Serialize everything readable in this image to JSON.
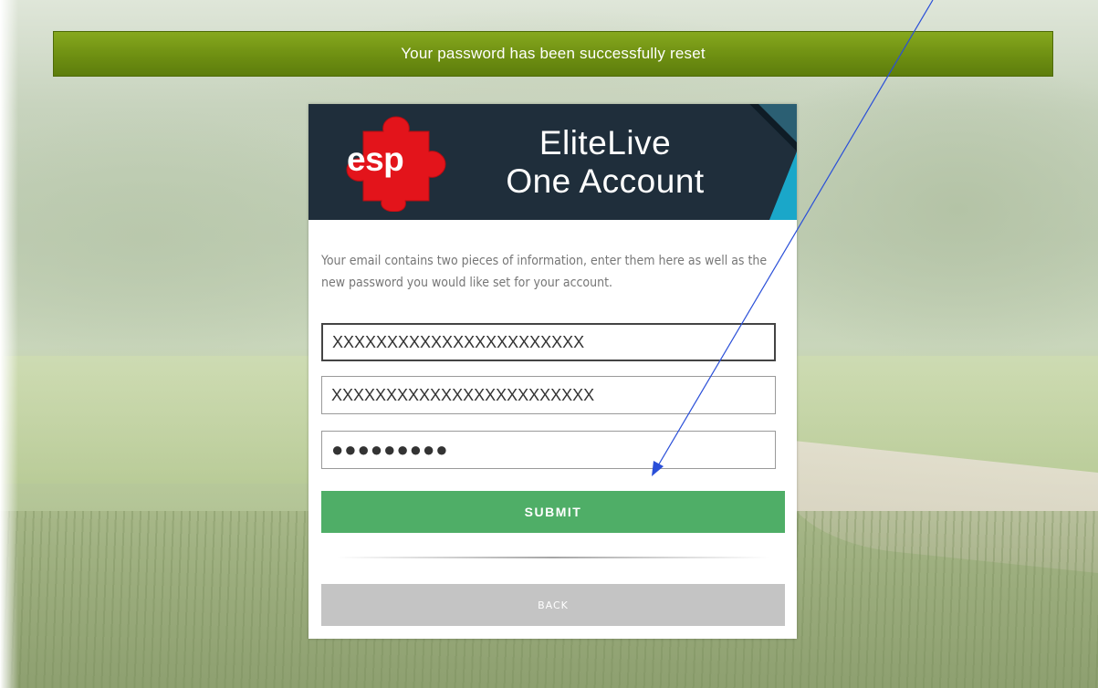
{
  "banner": {
    "message": "Your password has been successfully reset"
  },
  "brand": {
    "logo_text": "esp",
    "title_line1": "EliteLive",
    "title_line2": "One Account",
    "colors": {
      "header_bg": "#1f2e3b",
      "logo_red": "#e3141b",
      "accent_teal": "#1aa7c9"
    }
  },
  "form": {
    "instructions": "Your email contains two pieces of information, enter them here as well as the new password you would like set for your account.",
    "field1_value": "XXXXXXXXXXXXXXXXXXXXXXX",
    "field2_value": "XXXXXXXXXXXXXXXXXXXXXXXX",
    "password_value": "●●●●●●●●●",
    "submit_label": "SUBMIT",
    "back_label": "BACK",
    "colors": {
      "submit_bg": "#4fae67",
      "back_bg": "#c4c4c4",
      "banner_green": "#6e8f12"
    }
  },
  "annotation": {
    "type": "arrow",
    "color": "#2a4fd8"
  }
}
